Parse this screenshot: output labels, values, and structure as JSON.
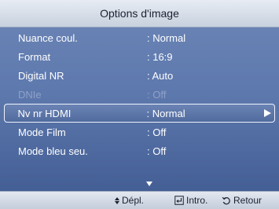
{
  "header": {
    "title": "Options d'image"
  },
  "menu": {
    "items": [
      {
        "label": "Nuance coul.",
        "value": ": Normal"
      },
      {
        "label": "Format",
        "value": ": 16:9"
      },
      {
        "label": "Digital NR",
        "value": ": Auto"
      },
      {
        "label": "DNIe",
        "value": ": Off",
        "disabled": true
      },
      {
        "label": "Nv nr HDMI",
        "value": ": Normal",
        "selected": true
      },
      {
        "label": "Mode Film",
        "value": ": Off"
      },
      {
        "label": "Mode bleu seu.",
        "value": ": Off"
      }
    ],
    "more_indicator_icon": "chevron-down-icon"
  },
  "footer": {
    "move_label": "Dépl.",
    "enter_label": "Intro.",
    "return_label": "Retour",
    "move_icon": "updown-arrows-icon",
    "enter_icon": "enter-icon",
    "return_icon": "return-icon"
  },
  "colors": {
    "panel_top": "#6d86b7",
    "panel_bottom": "#3f5a90",
    "bar": "#d4dbe6",
    "text": "#ffffff",
    "disabled_text": "#8ea2c9",
    "bar_text": "#1b2130"
  }
}
